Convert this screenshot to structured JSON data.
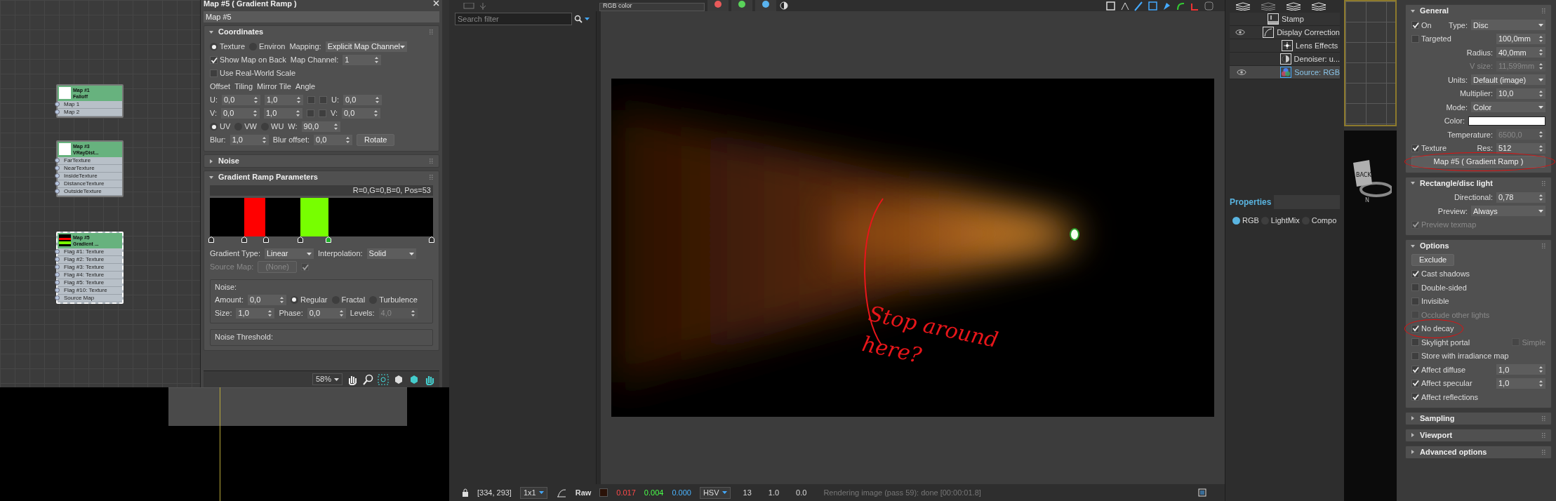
{
  "node_editor": {
    "nodes": [
      {
        "title": "Map #1",
        "subtitle": "Falloff",
        "selected": false,
        "kind": "plain",
        "slots": [
          "Map 1",
          "Map 2"
        ]
      },
      {
        "title": "Map #3",
        "subtitle": "VRayDist...",
        "selected": false,
        "kind": "plain",
        "slots": [
          "FarTexture",
          "NearTexture",
          "InsideTexture",
          "DistanceTexture",
          "OutsideTexture"
        ]
      },
      {
        "title": "Map #5",
        "subtitle": "Gradient ...",
        "selected": true,
        "kind": "ramp",
        "slots": [
          "Flag #1: Texture",
          "Flag #2: Texture",
          "Flag #3: Texture",
          "Flag #4: Texture",
          "Flag #5: Texture",
          "Flag #10: Texture",
          "Source Map"
        ]
      }
    ]
  },
  "material_editor": {
    "title": "Map #5  ( Gradient Ramp )",
    "name": "Map #5",
    "rollouts": [
      {
        "title": "Coordinates",
        "expanded": true,
        "rows": [
          {
            "items": [
              {
                "kind": "radio",
                "label": "Texture",
                "selected": true
              },
              {
                "kind": "radio",
                "label": "Environ",
                "selected": false
              },
              {
                "kind": "label",
                "text": "Mapping:"
              },
              {
                "kind": "dropdown",
                "value": "Explicit Map Channel"
              }
            ]
          },
          {
            "items": [
              {
                "kind": "check",
                "label": "Show Map on Back",
                "checked": true
              },
              {
                "kind": "label",
                "text": "Map Channel:"
              },
              {
                "kind": "spinner",
                "value": "1"
              }
            ]
          },
          {
            "items": [
              {
                "kind": "check",
                "label": "Use Real-World Scale",
                "checked": false
              }
            ]
          },
          {
            "items": [
              {
                "kind": "label",
                "text": "Offset"
              },
              {
                "kind": "label",
                "text": "Tiling"
              },
              {
                "kind": "label",
                "text": "Mirror Tile"
              },
              {
                "kind": "label",
                "text": "Angle"
              }
            ]
          },
          {
            "items": [
              {
                "kind": "label",
                "text": "U:"
              },
              {
                "kind": "spinner",
                "value": "0,0"
              },
              {
                "kind": "spinner",
                "value": "1,0"
              },
              {
                "kind": "check",
                "checked": false
              },
              {
                "kind": "check",
                "checked": false
              },
              {
                "kind": "label",
                "text": "U:"
              },
              {
                "kind": "spinner",
                "value": "0,0"
              }
            ]
          },
          {
            "items": [
              {
                "kind": "label",
                "text": "V:"
              },
              {
                "kind": "spinner",
                "value": "0,0"
              },
              {
                "kind": "spinner",
                "value": "1,0"
              },
              {
                "kind": "check",
                "checked": false
              },
              {
                "kind": "check",
                "checked": false
              },
              {
                "kind": "label",
                "text": "V:"
              },
              {
                "kind": "spinner",
                "value": "0,0"
              }
            ]
          },
          {
            "items": [
              {
                "kind": "radio",
                "label": "UV",
                "selected": true
              },
              {
                "kind": "radio",
                "label": "VW",
                "selected": false
              },
              {
                "kind": "radio",
                "label": "WU",
                "selected": false
              },
              {
                "kind": "label",
                "text": "W:"
              },
              {
                "kind": "spinner",
                "value": "90,0"
              }
            ]
          },
          {
            "items": [
              {
                "kind": "label",
                "text": "Blur:"
              },
              {
                "kind": "spinner",
                "value": "1,0"
              },
              {
                "kind": "label",
                "text": "Blur offset:"
              },
              {
                "kind": "spinner",
                "value": "0,0"
              },
              {
                "kind": "button",
                "label": "Rotate"
              }
            ]
          }
        ]
      },
      {
        "title": "Noise",
        "expanded": false
      },
      {
        "title": "Gradient Ramp Parameters",
        "expanded": true,
        "ramp": {
          "info": "R=0,G=0,B=0, Pos=53",
          "flags": [
            {
              "selected": false
            },
            {
              "selected": false
            },
            {
              "selected": false
            },
            {
              "selected": false
            },
            {
              "selected": true
            },
            {
              "selected": false
            }
          ]
        },
        "rows": [
          {
            "items": [
              {
                "kind": "label",
                "text": "Gradient Type:"
              },
              {
                "kind": "dropdown",
                "value": "Linear"
              },
              {
                "kind": "label",
                "text": "Interpolation:"
              },
              {
                "kind": "dropdown",
                "value": "Solid"
              }
            ]
          },
          {
            "items": [
              {
                "kind": "label",
                "text": "Source Map:",
                "disabled": true
              },
              {
                "kind": "button",
                "label": "(None)",
                "disabled": true
              },
              {
                "kind": "check",
                "checked": true,
                "disabled": true
              }
            ]
          }
        ],
        "groups": [
          {
            "title": "Noise:",
            "rows": [
              {
                "items": [
                  {
                    "kind": "label",
                    "text": "Amount:"
                  },
                  {
                    "kind": "spinner",
                    "value": "0,0"
                  },
                  {
                    "kind": "radio",
                    "label": "Regular",
                    "selected": true
                  },
                  {
                    "kind": "radio",
                    "label": "Fractal",
                    "selected": false
                  },
                  {
                    "kind": "radio",
                    "label": "Turbulence",
                    "selected": false
                  }
                ]
              },
              {
                "items": [
                  {
                    "kind": "label",
                    "text": "Size:"
                  },
                  {
                    "kind": "spinner",
                    "value": "1,0"
                  },
                  {
                    "kind": "label",
                    "text": "Phase:"
                  },
                  {
                    "kind": "spinner",
                    "value": "0,0"
                  },
                  {
                    "kind": "label",
                    "text": "Levels:"
                  },
                  {
                    "kind": "spinner",
                    "value": "4,0",
                    "disabled": true
                  }
                ]
              }
            ]
          },
          {
            "title": "Noise Threshold:"
          }
        ]
      }
    ],
    "zoom": "58%"
  },
  "frame_buffer": {
    "channel": "RGB color",
    "color_buttons": [
      {
        "color": "#e85a5a"
      },
      {
        "color": "#5ad35a"
      },
      {
        "color": "#5ab4f0"
      }
    ],
    "search": {
      "placeholder": "Search filter"
    },
    "annotation": "Stop around here?",
    "status": {
      "coords": "[334, 293]",
      "zoom": "1x1",
      "mode": "Raw",
      "pixel": {
        "color": "#2a1208"
      },
      "values": [
        "0.017",
        "0.004",
        "0.000"
      ],
      "space": "HSV",
      "readings": [
        "13",
        "1.0",
        "0.0"
      ],
      "message": "Rendering image (pass 59): done [00:00:01.8]"
    }
  },
  "layers": {
    "items": [
      {
        "label": "Stamp",
        "kind": "stamp",
        "visible": false,
        "selected": false
      },
      {
        "label": "Display Correction",
        "kind": "curve",
        "visible": true,
        "selected": false,
        "children": [
          {
            "label": "Lens Effects",
            "kind": "lens",
            "visible": false,
            "selected": false
          },
          {
            "label": "Denoiser: u...",
            "kind": "denoiser",
            "visible": false,
            "selected": false
          },
          {
            "label": "Source: RGB",
            "kind": "source",
            "visible": true,
            "selected": true
          }
        ]
      }
    ],
    "properties": {
      "title": "Properties",
      "modes": [
        {
          "label": "RGB",
          "selected": true
        },
        {
          "label": "LightMix",
          "selected": false
        },
        {
          "label": "Compo",
          "selected": false
        }
      ]
    }
  },
  "viewport": {
    "face_label": "BACK",
    "compass": "N"
  },
  "command_panel": {
    "rollouts": [
      {
        "title": "General",
        "expanded": true,
        "rows": [
          {
            "items": [
              {
                "kind": "check",
                "label": "On",
                "checked": true
              },
              {
                "kind": "label",
                "text": "Type:"
              },
              {
                "kind": "dropdown",
                "value": "Disc"
              }
            ]
          },
          {
            "items": [
              {
                "kind": "check",
                "label": "Targeted",
                "checked": false
              },
              {
                "kind": "spinner",
                "value": "100,0mm"
              }
            ]
          },
          {
            "items": [
              {
                "kind": "label",
                "text": "Radius:"
              },
              {
                "kind": "spinner",
                "value": "40,0mm"
              }
            ]
          },
          {
            "items": [
              {
                "kind": "label",
                "text": "V size:",
                "disabled": true
              },
              {
                "kind": "spinner",
                "value": "11,599mm",
                "disabled": true
              }
            ]
          },
          {
            "items": [
              {
                "kind": "label",
                "text": "Units:"
              },
              {
                "kind": "dropdown",
                "value": "Default (image)"
              }
            ]
          },
          {
            "items": [
              {
                "kind": "label",
                "text": "Multiplier:"
              },
              {
                "kind": "spinner",
                "value": "10,0"
              }
            ]
          },
          {
            "items": [
              {
                "kind": "label",
                "text": "Mode:"
              },
              {
                "kind": "dropdown",
                "value": "Color"
              }
            ]
          },
          {
            "items": [
              {
                "kind": "label",
                "text": "Color:"
              },
              {
                "kind": "swatch",
                "color": "#ffffff"
              }
            ]
          },
          {
            "items": [
              {
                "kind": "label",
                "text": "Temperature:"
              },
              {
                "kind": "spinner",
                "value": "6500,0",
                "disabled": true
              }
            ]
          },
          {
            "items": [
              {
                "kind": "check",
                "label": "Texture",
                "checked": true
              },
              {
                "kind": "label",
                "text": "Res:"
              },
              {
                "kind": "spinner",
                "value": "512"
              }
            ]
          },
          {
            "items": [
              {
                "kind": "button",
                "label": "Map #5  ( Gradient Ramp )",
                "circled": true
              }
            ]
          }
        ]
      },
      {
        "title": "Rectangle/disc light",
        "expanded": true,
        "rows": [
          {
            "items": [
              {
                "kind": "label",
                "text": "Directional:"
              },
              {
                "kind": "spinner",
                "value": "0,78"
              }
            ]
          },
          {
            "items": [
              {
                "kind": "label",
                "text": "Preview:"
              },
              {
                "kind": "dropdown",
                "value": "Always"
              }
            ]
          },
          {
            "items": [
              {
                "kind": "check",
                "label": "Preview texmap",
                "checked": true,
                "disabled": true
              }
            ]
          }
        ]
      },
      {
        "title": "Options",
        "expanded": true,
        "rows": [
          {
            "items": [
              {
                "kind": "button",
                "label": "Exclude"
              }
            ]
          },
          {
            "items": [
              {
                "kind": "check",
                "label": "Cast shadows",
                "checked": true
              }
            ]
          },
          {
            "items": [
              {
                "kind": "check",
                "label": "Double-sided",
                "checked": false
              }
            ]
          },
          {
            "items": [
              {
                "kind": "check",
                "label": "Invisible",
                "checked": false
              }
            ]
          },
          {
            "items": [
              {
                "kind": "check",
                "label": "Occlude other lights",
                "checked": false,
                "disabled": true
              }
            ]
          },
          {
            "items": [
              {
                "kind": "check",
                "label": "No decay",
                "checked": true,
                "circled": true
              }
            ]
          },
          {
            "items": [
              {
                "kind": "check",
                "label": "Skylight portal",
                "checked": false
              },
              {
                "kind": "check",
                "label": "Simple",
                "checked": false,
                "disabled": true
              }
            ]
          },
          {
            "items": [
              {
                "kind": "check",
                "label": "Store with irradiance map",
                "checked": false
              }
            ]
          },
          {
            "items": [
              {
                "kind": "check",
                "label": "Affect diffuse",
                "checked": true
              },
              {
                "kind": "spinner",
                "value": "1,0"
              }
            ]
          },
          {
            "items": [
              {
                "kind": "check",
                "label": "Affect specular",
                "checked": true
              },
              {
                "kind": "spinner",
                "value": "1,0"
              }
            ]
          },
          {
            "items": [
              {
                "kind": "check",
                "label": "Affect reflections",
                "checked": true
              }
            ]
          }
        ]
      },
      {
        "title": "Sampling",
        "expanded": false
      },
      {
        "title": "Viewport",
        "expanded": false
      },
      {
        "title": "Advanced options",
        "expanded": false
      }
    ]
  }
}
